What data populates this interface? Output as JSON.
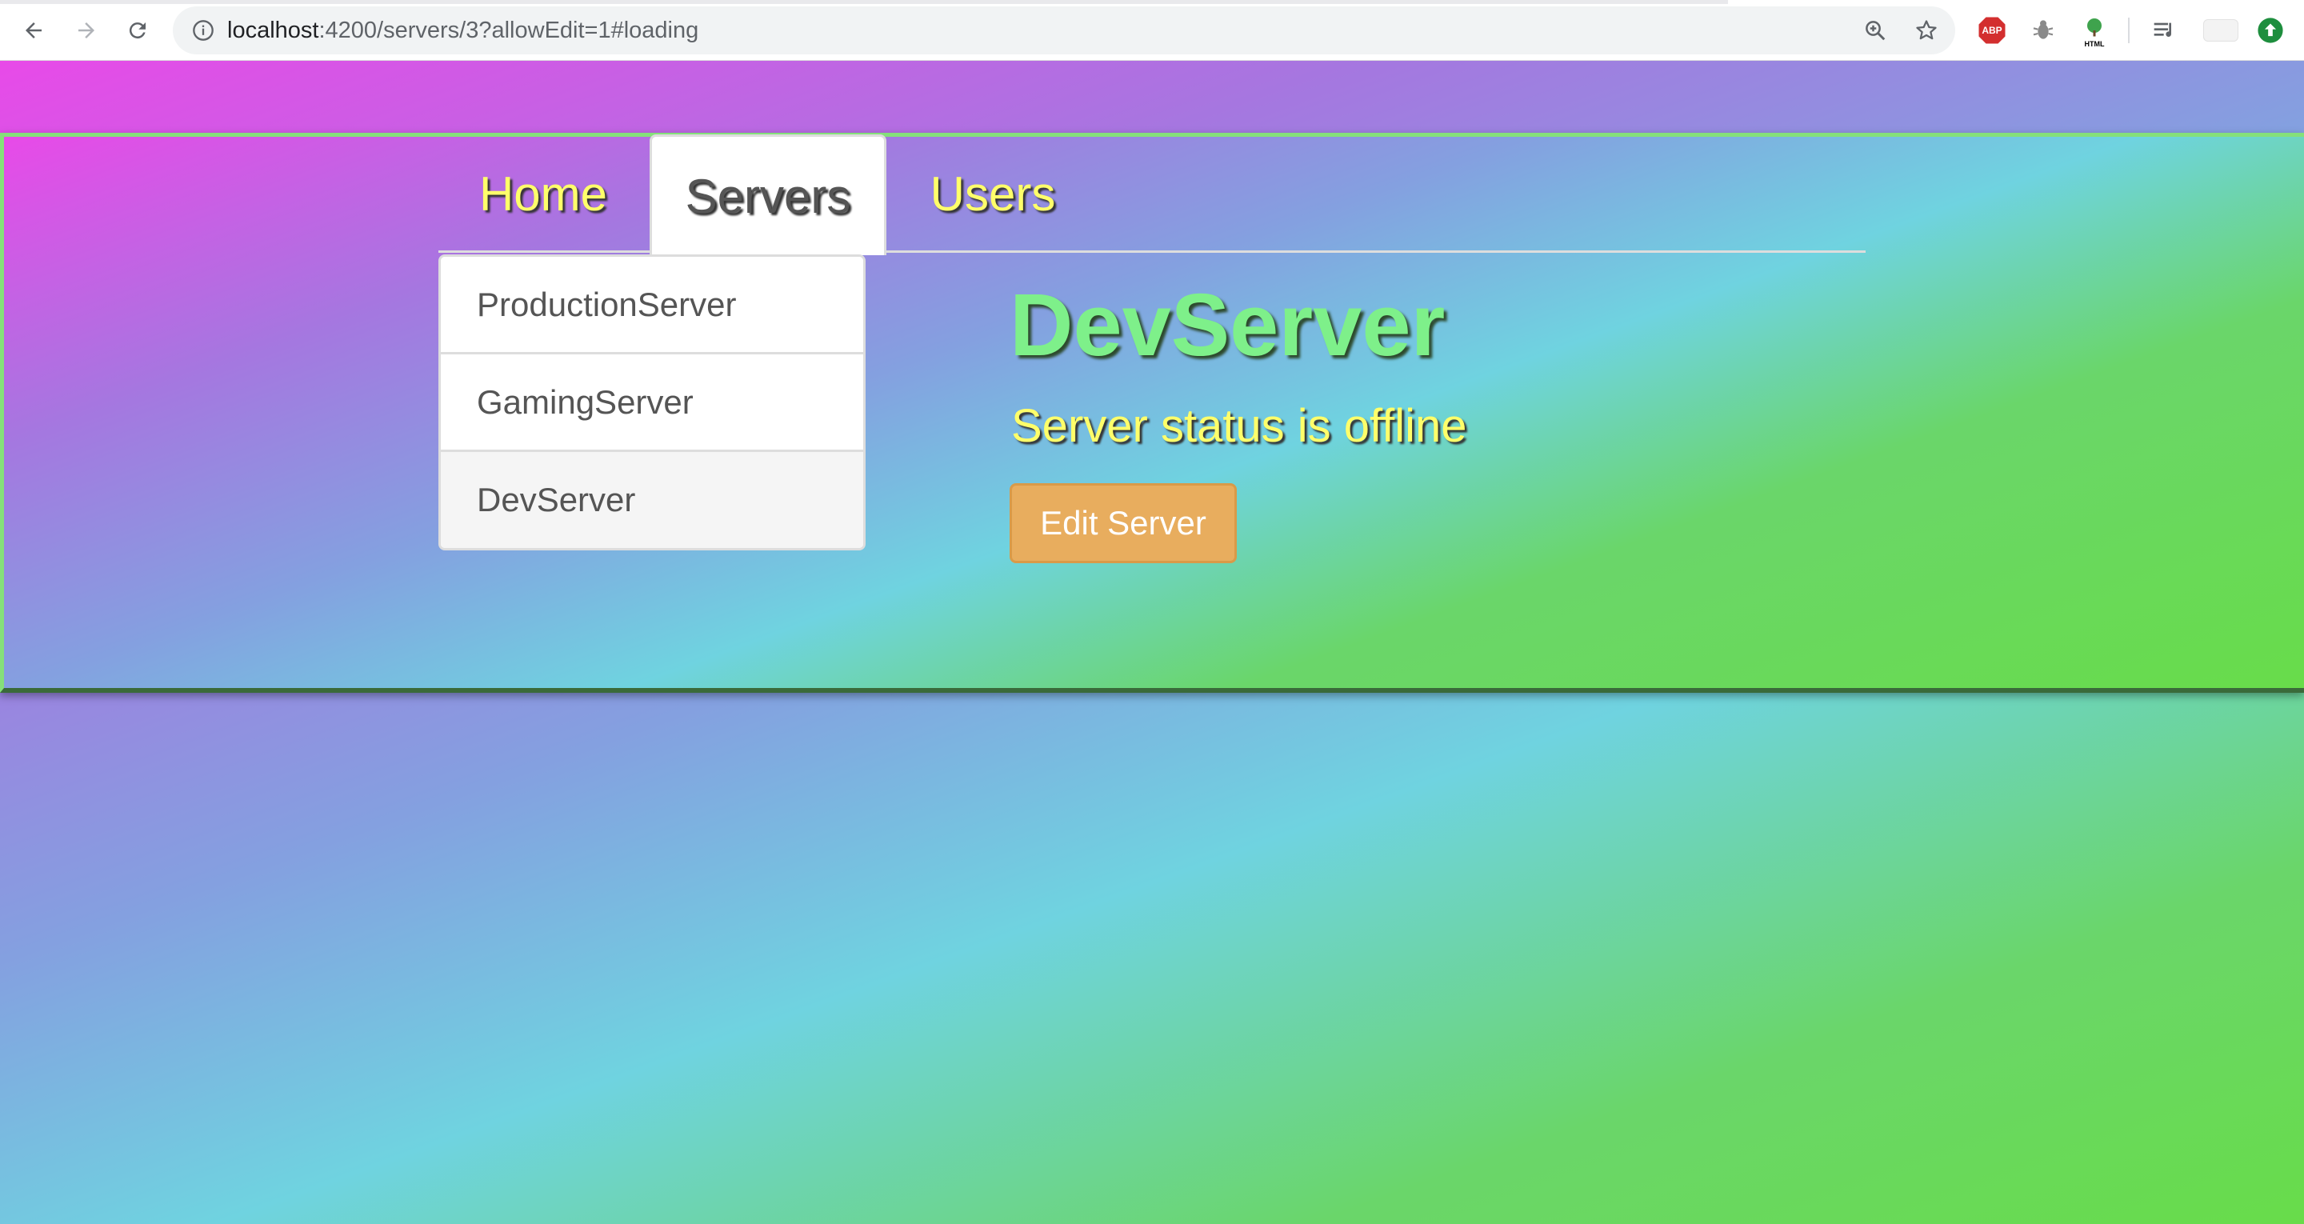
{
  "browser": {
    "url_host": "localhost",
    "url_path": ":4200/servers/3?allowEdit=1#loading",
    "icons": {
      "back": "back-arrow-icon",
      "forward": "forward-arrow-icon",
      "reload": "reload-icon",
      "info": "info-icon",
      "zoom": "zoom-icon",
      "bookmark": "star-icon"
    },
    "extensions": [
      "adblock-icon",
      "bug-icon",
      "tree-html-icon",
      "reading-list-icon",
      "profile-icon",
      "update-icon"
    ],
    "abp_label": "ABP",
    "html_label": "HTML"
  },
  "nav": {
    "tabs": [
      {
        "label": "Home",
        "active": false
      },
      {
        "label": "Servers",
        "active": true
      },
      {
        "label": "Users",
        "active": false
      }
    ]
  },
  "servers": {
    "items": [
      {
        "label": "ProductionServer",
        "active": false
      },
      {
        "label": "GamingServer",
        "active": false
      },
      {
        "label": "DevServer",
        "active": true
      }
    ]
  },
  "detail": {
    "name": "DevServer",
    "status_text": "Server status is offline",
    "edit_label": "Edit Server"
  },
  "colors": {
    "title": "#7ef08a",
    "status": "#ffff6a",
    "button": "#e8ad5e"
  }
}
